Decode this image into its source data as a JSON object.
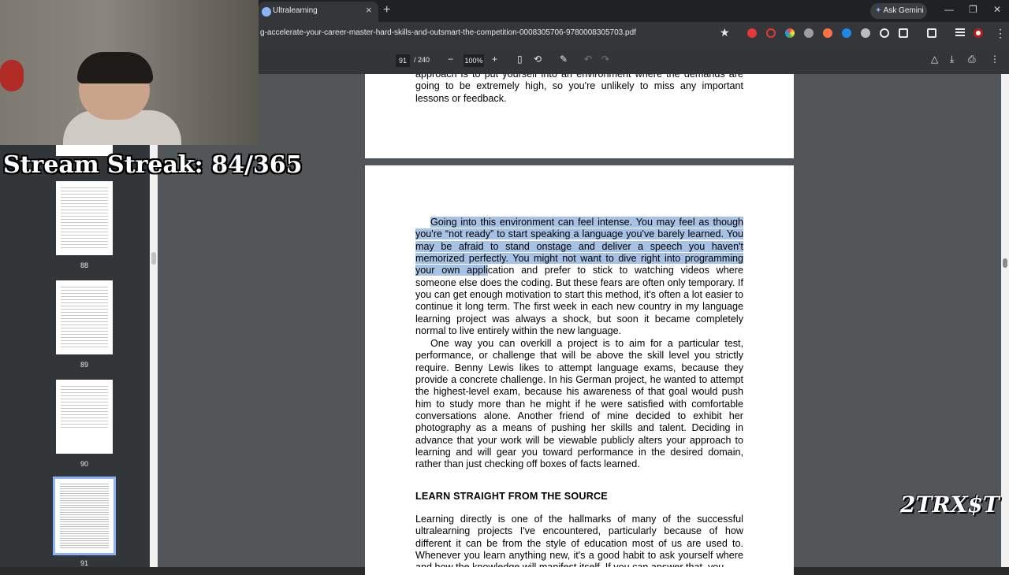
{
  "stream": {
    "streak_label": "Stream Streak: 84/365"
  },
  "browser": {
    "tab_title": "Ultralearning",
    "tab_close": "×",
    "new_tab": "+",
    "ask_gemini": "Ask Gemini",
    "url": "g-accelerate-your-career-master-hard-skills-and-outsmart-the-competition-0008305706-9780008305703.pdf",
    "minimize": "—",
    "restore": "❐",
    "close": "✕"
  },
  "pdf_toolbar": {
    "current_page": "91",
    "total_pages": "/ 240",
    "zoom_out": "−",
    "zoom": "100%",
    "zoom_in": "+"
  },
  "sidebar": {
    "pages": [
      {
        "number": "88"
      },
      {
        "number": "89"
      },
      {
        "number": "90"
      },
      {
        "number": "91"
      }
    ]
  },
  "document": {
    "prev_page_text": "approach is to put yourself into an environment where the demands are going to be extremely high, so you're unlikely to miss any important lessons or feedback.",
    "para1_highlight": "Going into this environment can feel intense. You may feel as though you're “not ready” to start speaking a language you've barely learned. You may be afraid to stand onstage and deliver a speech you haven't memorized perfectly. You might not want to dive right into programming your own appli",
    "para1_rest": "cation and prefer to stick to watching videos where someone else does the coding. But these fears are often only temporary. If you can get enough motivation to start this method, it's often a lot easier to continue it long term. The first week in each new country in my language learning project was always a shock, but soon it became completely normal to live entirely within the new language.",
    "para2": "One way you can overkill a project is to aim for a particular test, performance, or challenge that will be above the skill level you strictly require. Benny Lewis likes to attempt language exams, because they provide a concrete challenge. In his German project, he wanted to attempt the highest-level exam, because his awareness of that goal would push him to study more than he might if he were satisfied with comfortable conversations alone. Another friend of mine decided to exhibit her photography as a means of pushing her skills and talent. Deciding in advance that your work will be viewable publicly alters your approach to learning and will gear you toward performance in the desired domain, rather than just checking off boxes of facts learned.",
    "heading": "LEARN STRAIGHT FROM THE SOURCE",
    "para3": "Learning directly is one of the hallmarks of many of the successful ultralearning projects I've encountered, particularly because of how different it can be from the style of education most of us are used to. Whenever you learn anything new, it's a good habit to ask yourself where and how the knowledge will manifest itself. If you can answer that, you"
  },
  "overlay": {
    "logo_text": "2TRX$T"
  }
}
